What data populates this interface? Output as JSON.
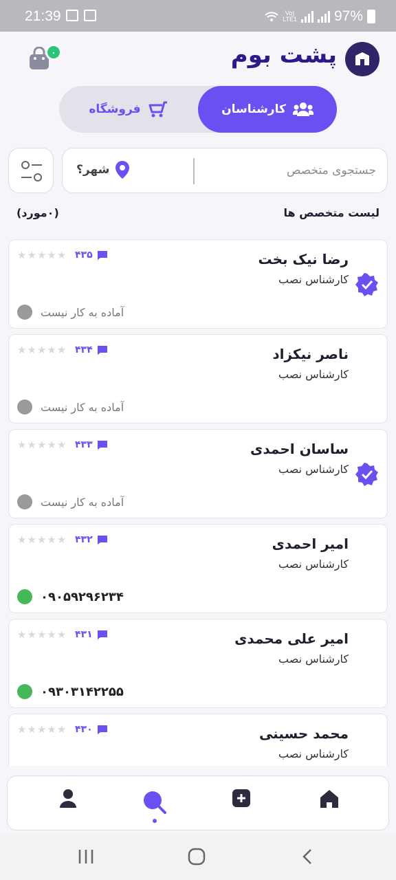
{
  "status_bar": {
    "time": "21:39",
    "battery": "97%",
    "lte_top": "Vo)",
    "lte_bottom": "LTE1"
  },
  "header": {
    "logo_text": "پشت بوم",
    "cart_badge": "۰"
  },
  "tabs": {
    "experts": "کارشناسان",
    "shop": "فروشگاه"
  },
  "search": {
    "placeholder": "جستجوی متخصص",
    "city_label": "شهر؟"
  },
  "list": {
    "title": "لیست متخصص ها",
    "count": "(۰مورد)",
    "items": [
      {
        "name": "رضا نیک بخت",
        "role": "کارشناس نصب",
        "comments": "۴۳۵",
        "verified": true,
        "status": "آماده به کار نیست",
        "available": false,
        "rating": 0
      },
      {
        "name": "ناصر نیکزاد",
        "role": "کارشناس نصب",
        "comments": "۴۳۴",
        "verified": false,
        "status": "آماده به کار نیست",
        "available": false,
        "rating": 0
      },
      {
        "name": "ساسان احمدی",
        "role": "کارشناس نصب",
        "comments": "۴۳۳",
        "verified": true,
        "status": "آماده به کار نیست",
        "available": false,
        "rating": 0
      },
      {
        "name": "امیر احمدی",
        "role": "کارشناس نصب",
        "comments": "۴۳۲",
        "verified": false,
        "phone": "۰۹۰۵۹۲۹۶۲۳۴",
        "available": true,
        "rating": 0
      },
      {
        "name": "امیر علی محمدی",
        "role": "کارشناس نصب",
        "comments": "۴۳۱",
        "verified": false,
        "phone": "۰۹۳۰۳۱۴۲۲۵۵",
        "available": true,
        "rating": 0
      },
      {
        "name": "محمد حسینی",
        "role": "کارشناس نصب",
        "comments": "۴۳۰",
        "verified": false,
        "available": false,
        "rating": 0
      }
    ]
  },
  "colors": {
    "accent": "#6c4ff0",
    "brand_dark": "#2f2569",
    "available": "#46b85a",
    "unavailable": "#9a9a9a",
    "badge": "#2ec37a"
  },
  "icons": {
    "nav": [
      "profile-icon",
      "search-icon",
      "add-icon",
      "home-icon"
    ],
    "system": [
      "recents-icon",
      "home-circle-icon",
      "back-icon"
    ]
  }
}
